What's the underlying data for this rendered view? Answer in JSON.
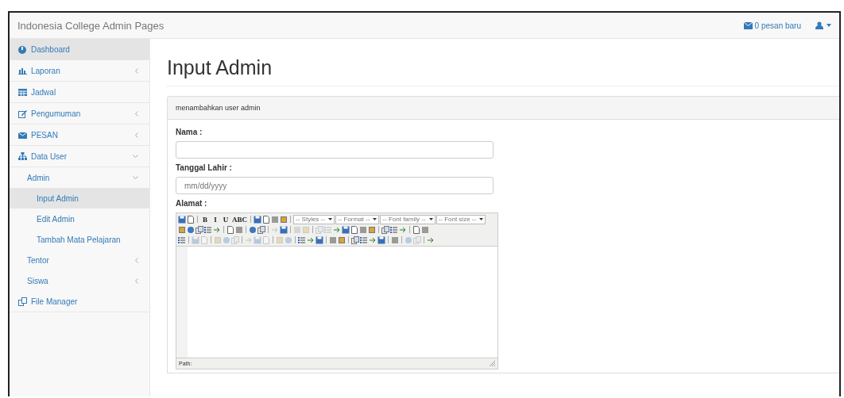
{
  "navbar": {
    "title": "Indonesia College Admin Pages",
    "messages": "0 pesan baru"
  },
  "sidebar": {
    "items": [
      {
        "label": "Dashboard",
        "selected": true
      },
      {
        "label": "Laporan",
        "selected": false,
        "expanded": false
      },
      {
        "label": "Jadwal",
        "selected": false
      },
      {
        "label": "Pengumuman",
        "selected": false,
        "expanded": false
      },
      {
        "label": "PESAN",
        "selected": false,
        "expanded": false
      },
      {
        "label": "Data User",
        "selected": false,
        "expanded": true,
        "children": [
          {
            "label": "Admin",
            "selected": false,
            "expanded": true,
            "children": [
              {
                "label": "Input Admin",
                "selected": true
              },
              {
                "label": "Edit Admin",
                "selected": false
              },
              {
                "label": "Tambah Mata Pelajaran",
                "selected": false
              }
            ]
          },
          {
            "label": "Tentor",
            "selected": false,
            "expanded": false
          },
          {
            "label": "Siswa",
            "selected": false,
            "expanded": false
          }
        ]
      },
      {
        "label": "File Manager",
        "selected": false
      }
    ]
  },
  "page": {
    "title": "Input Admin"
  },
  "panel": {
    "heading": "menambahkan user admin",
    "fields": [
      {
        "label": "Nama :",
        "kind": "text"
      },
      {
        "label": "Tanggal Lahir :",
        "kind": "date",
        "placeholder": "mm/dd/yyyy"
      },
      {
        "label": "Alamat :",
        "kind": "editor"
      }
    ]
  },
  "editor": {
    "toolbar": [
      [
        {
          "kind": "icon",
          "disabled": false
        },
        {
          "kind": "icon",
          "disabled": false
        },
        {
          "kind": "separator"
        },
        {
          "kind": "glyph",
          "label": "B",
          "disabled": false
        },
        {
          "kind": "glyph",
          "label": "I",
          "disabled": false
        },
        {
          "kind": "glyph",
          "label": "U",
          "disabled": false
        },
        {
          "kind": "glyph",
          "label": "ABC",
          "disabled": false
        },
        {
          "kind": "separator"
        },
        {
          "kind": "icon",
          "disabled": false
        },
        {
          "kind": "icon",
          "disabled": false
        },
        {
          "kind": "icon",
          "disabled": false
        },
        {
          "kind": "icon",
          "disabled": false
        },
        {
          "kind": "separator"
        },
        {
          "kind": "dropdown",
          "label": "-- Styles --"
        },
        {
          "kind": "dropdown",
          "label": "-- Format --"
        },
        {
          "kind": "dropdown",
          "label": "-- Font family --"
        },
        {
          "kind": "dropdown",
          "label": "-- Font size --"
        }
      ],
      [
        {
          "kind": "icon",
          "disabled": false
        },
        {
          "kind": "icon",
          "disabled": false
        },
        {
          "kind": "icon",
          "disabled": false
        },
        {
          "kind": "icon",
          "disabled": false
        },
        {
          "kind": "icon",
          "disabled": false
        },
        {
          "kind": "separator"
        },
        {
          "kind": "icon",
          "disabled": false
        },
        {
          "kind": "icon",
          "disabled": false
        },
        {
          "kind": "separator"
        },
        {
          "kind": "icon",
          "disabled": false
        },
        {
          "kind": "icon",
          "disabled": false
        },
        {
          "kind": "separator"
        },
        {
          "kind": "icon",
          "disabled": true
        },
        {
          "kind": "icon",
          "disabled": false
        },
        {
          "kind": "separator"
        },
        {
          "kind": "icon",
          "disabled": true
        },
        {
          "kind": "icon",
          "disabled": true
        },
        {
          "kind": "separator"
        },
        {
          "kind": "icon",
          "disabled": true
        },
        {
          "kind": "icon",
          "disabled": true
        },
        {
          "kind": "icon",
          "disabled": false
        },
        {
          "kind": "icon",
          "disabled": false
        },
        {
          "kind": "icon",
          "disabled": false
        },
        {
          "kind": "icon",
          "disabled": false
        },
        {
          "kind": "icon",
          "disabled": false
        },
        {
          "kind": "separator"
        },
        {
          "kind": "icon",
          "disabled": false
        },
        {
          "kind": "icon",
          "disabled": false
        },
        {
          "kind": "icon",
          "disabled": false
        },
        {
          "kind": "separator"
        },
        {
          "kind": "icon",
          "disabled": false
        },
        {
          "kind": "icon",
          "disabled": false
        }
      ],
      [
        {
          "kind": "icon",
          "disabled": false
        },
        {
          "kind": "separator"
        },
        {
          "kind": "icon",
          "disabled": true
        },
        {
          "kind": "icon",
          "disabled": true
        },
        {
          "kind": "separator"
        },
        {
          "kind": "icon",
          "disabled": true
        },
        {
          "kind": "icon",
          "disabled": true
        },
        {
          "kind": "icon",
          "disabled": true
        },
        {
          "kind": "separator"
        },
        {
          "kind": "icon",
          "disabled": true
        },
        {
          "kind": "icon",
          "disabled": true
        },
        {
          "kind": "icon",
          "disabled": true
        },
        {
          "kind": "separator"
        },
        {
          "kind": "icon",
          "disabled": true
        },
        {
          "kind": "icon",
          "disabled": true
        },
        {
          "kind": "separator"
        },
        {
          "kind": "icon",
          "disabled": false
        },
        {
          "kind": "icon",
          "disabled": false
        },
        {
          "kind": "icon",
          "disabled": false
        },
        {
          "kind": "separator"
        },
        {
          "kind": "icon",
          "disabled": false
        },
        {
          "kind": "icon",
          "disabled": false
        },
        {
          "kind": "separator"
        },
        {
          "kind": "icon",
          "disabled": false
        },
        {
          "kind": "icon",
          "disabled": false
        },
        {
          "kind": "icon",
          "disabled": false
        },
        {
          "kind": "icon",
          "disabled": false
        },
        {
          "kind": "separator"
        },
        {
          "kind": "icon",
          "disabled": false
        },
        {
          "kind": "separator"
        },
        {
          "kind": "icon",
          "disabled": true
        },
        {
          "kind": "icon",
          "disabled": true
        },
        {
          "kind": "separator"
        },
        {
          "kind": "icon",
          "disabled": false
        }
      ]
    ],
    "path_label": "Path:"
  }
}
